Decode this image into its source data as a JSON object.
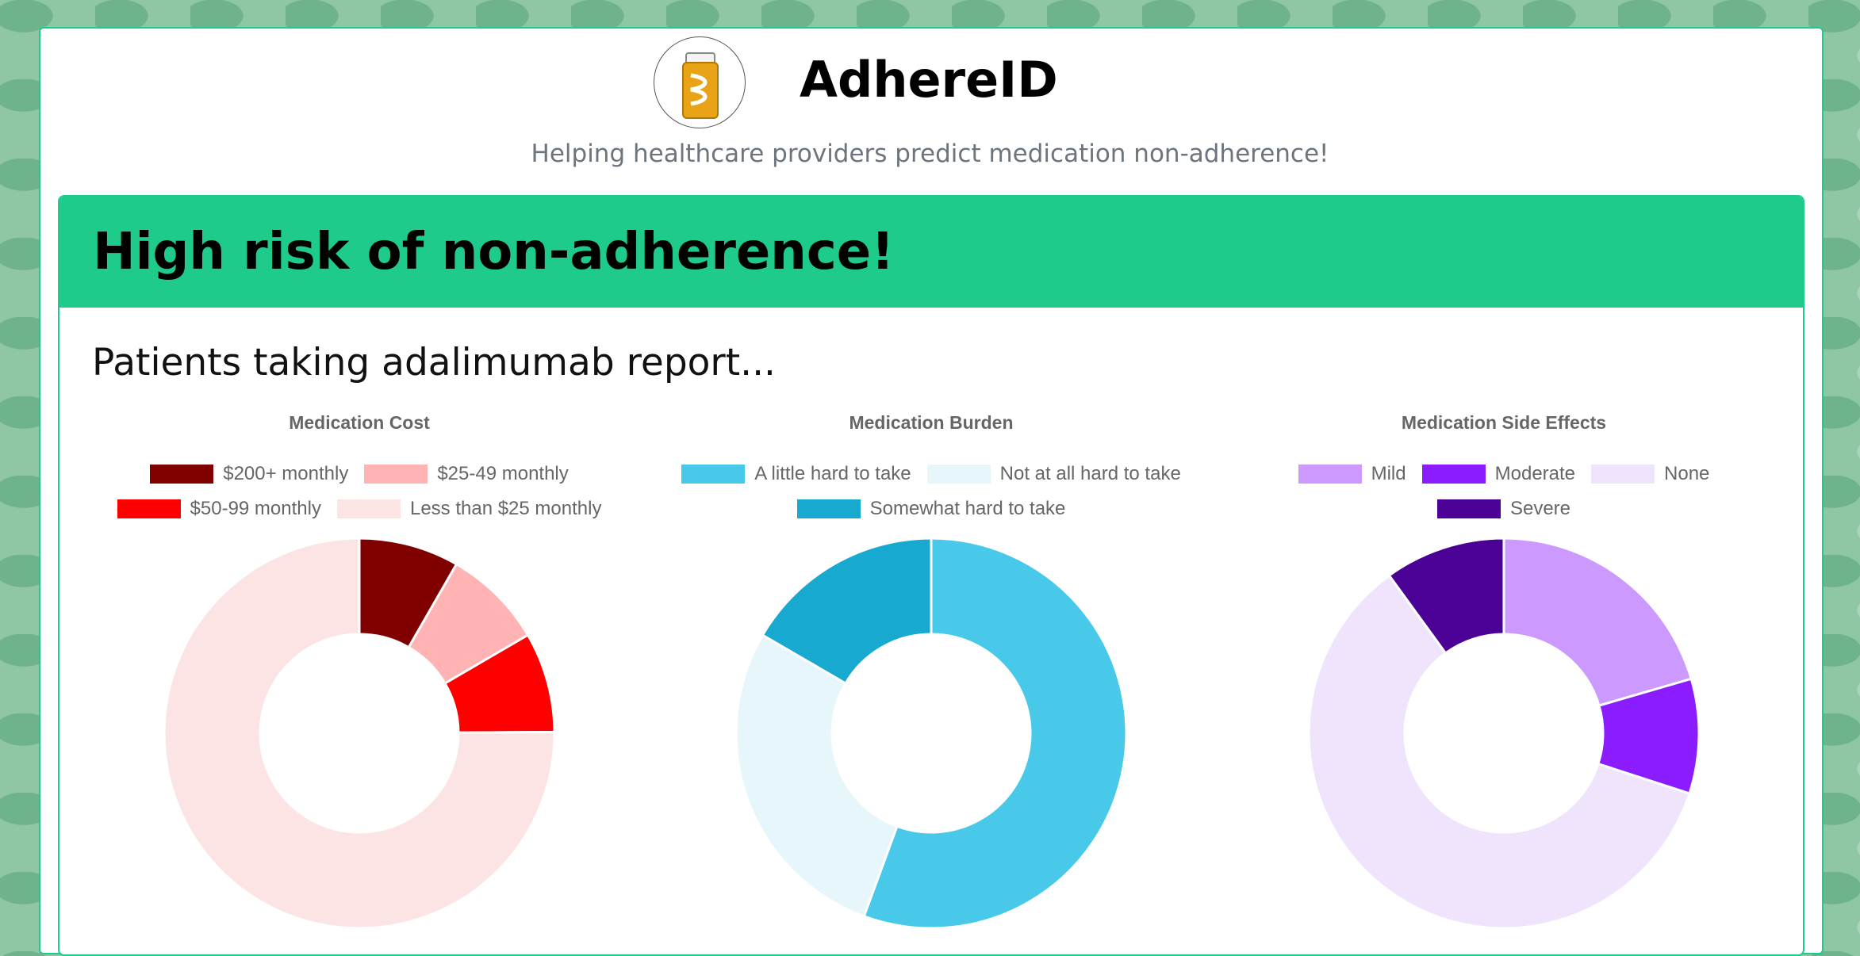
{
  "header": {
    "app_title": "AdhereID",
    "subtitle": "Helping healthcare providers predict medication non-adherence!"
  },
  "result": {
    "risk_banner": "High risk of non-adherence!",
    "report_line": "Patients taking adalimumab report..."
  },
  "colors": {
    "accent": "#1ecb8b",
    "background_pattern": "#8fc6a4"
  },
  "chart_data": [
    {
      "type": "pie",
      "title": "Medication Cost",
      "categories": [
        "$200+ monthly",
        "$25-49 monthly",
        "$50-99 monthly",
        "Less than $25 monthly"
      ],
      "values": [
        8.3,
        8.3,
        8.3,
        75.1
      ],
      "colors": [
        "#800000",
        "#ffb3b3",
        "#ff0000",
        "#fde4e4"
      ],
      "slice_order": [
        0,
        1,
        2,
        3
      ],
      "legend_rows": [
        [
          0,
          1
        ],
        [
          2,
          3
        ]
      ],
      "legend_position": "top"
    },
    {
      "type": "pie",
      "title": "Medication Burden",
      "categories": [
        "A little hard to take",
        "Not at all hard to take",
        "Somewhat hard to take"
      ],
      "values": [
        55.6,
        27.8,
        16.6
      ],
      "colors": [
        "#48c9ea",
        "#e6f6fb",
        "#17a9d0"
      ],
      "slice_order": [
        0,
        1,
        2
      ],
      "legend_rows": [
        [
          0,
          1
        ],
        [
          2
        ]
      ],
      "legend_position": "top"
    },
    {
      "type": "pie",
      "title": "Medication Side Effects",
      "categories": [
        "Mild",
        "Moderate",
        "None",
        "Severe"
      ],
      "values": [
        20.5,
        9.5,
        60,
        10
      ],
      "colors": [
        "#cc99ff",
        "#8a1cff",
        "#f0e4fd",
        "#4b0096"
      ],
      "slice_order": [
        0,
        1,
        2,
        3
      ],
      "legend_rows": [
        [
          0,
          1,
          2
        ],
        [
          3
        ]
      ],
      "legend_position": "top"
    }
  ]
}
